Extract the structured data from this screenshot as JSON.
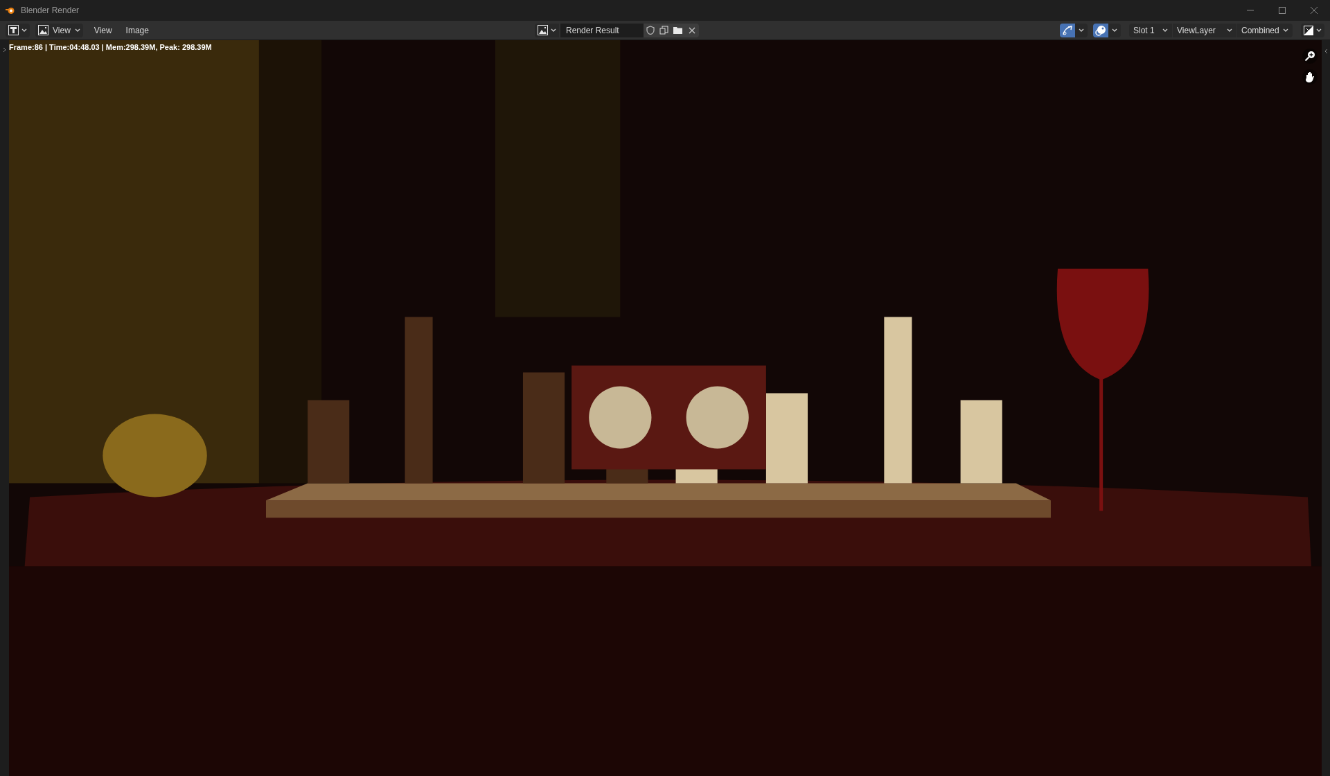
{
  "window": {
    "title": "Blender Render"
  },
  "header": {
    "editor_menu": "View",
    "menus": [
      "View",
      "Image"
    ],
    "image_name": "Render Result",
    "toggles": [
      {
        "on": true
      },
      {
        "on": true
      }
    ],
    "slot": "Slot 1",
    "view_layer": "ViewLayer",
    "pass": "Combined"
  },
  "render": {
    "info": "Frame:86 | Time:04:48.03 | Mem:298.39M, Peak: 298.39M"
  }
}
